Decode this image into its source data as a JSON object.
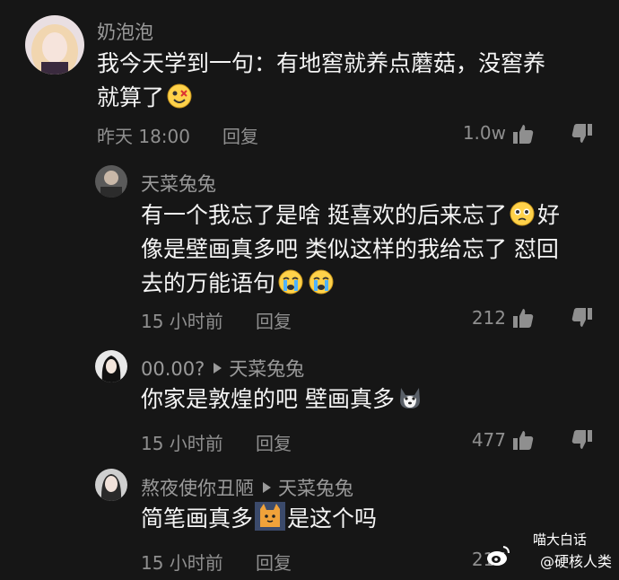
{
  "comments": [
    {
      "username": "奶泡泡",
      "text_parts": [
        "我今天学到一句：有地窖就养点蘑菇，没窖养",
        "就算了"
      ],
      "time": "昨天 18:00",
      "reply_label": "回复",
      "likes": "1.0w"
    },
    {
      "username": "天菜兔兔",
      "text_parts": [
        "有一个我忘了是啥 挺喜欢的后来忘了",
        "好",
        "像是壁画真多吧 类似这样的我给忘了 怼回",
        "去的万能语句"
      ],
      "time": "15 小时前",
      "reply_label": "回复",
      "likes": "212"
    },
    {
      "username": "00.00?",
      "reply_to": "天菜兔兔",
      "text_parts": [
        "你家是敦煌的吧 壁画真多"
      ],
      "time": "15 小时前",
      "reply_label": "回复",
      "likes": "477"
    },
    {
      "username": "熬夜使你丑陋",
      "reply_to": "天菜兔兔",
      "text_parts": [
        "简笔画真多",
        "是这个吗"
      ],
      "time": "15 小时前",
      "reply_label": "回复",
      "likes": "217"
    }
  ],
  "watermark": {
    "line1": "喵大白话",
    "line2": "@硬核人类"
  },
  "colors": {
    "background": "#161616",
    "text": "#f4f4f4",
    "muted": "#9a9a9a"
  }
}
